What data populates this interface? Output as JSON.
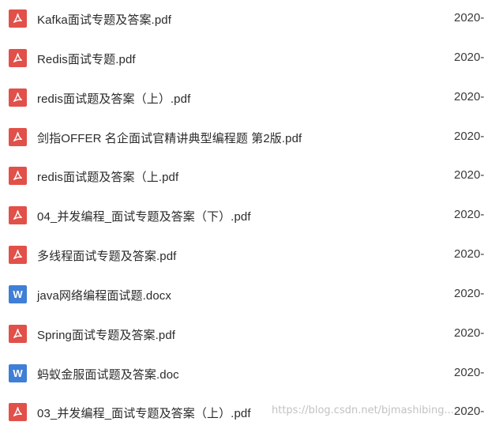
{
  "files": [
    {
      "name": "Kafka面试专题及答案.pdf",
      "date": "2020-",
      "icon": "pdf-icon",
      "icon_color": "#e2504a"
    },
    {
      "name": "Redis面试专题.pdf",
      "date": "2020-",
      "icon": "pdf-icon",
      "icon_color": "#e2504a"
    },
    {
      "name": "redis面试题及答案（上）.pdf",
      "date": "2020-",
      "icon": "pdf-icon",
      "icon_color": "#e2504a"
    },
    {
      "name": "剑指OFFER  名企面试官精讲典型编程题  第2版.pdf",
      "date": "2020-",
      "icon": "pdf-icon",
      "icon_color": "#e2504a"
    },
    {
      "name": "redis面试题及答案（上.pdf",
      "date": "2020-",
      "icon": "pdf-icon",
      "icon_color": "#e2504a"
    },
    {
      "name": "04_并发编程_面试专题及答案（下）.pdf",
      "date": "2020-",
      "icon": "pdf-icon",
      "icon_color": "#e2504a"
    },
    {
      "name": "多线程面试专题及答案.pdf",
      "date": "2020-",
      "icon": "pdf-icon",
      "icon_color": "#e2504a"
    },
    {
      "name": "java网络编程面试题.docx",
      "date": "2020-",
      "icon": "word-icon",
      "icon_color": "#3f7fd6"
    },
    {
      "name": "Spring面试专题及答案.pdf",
      "date": "2020-",
      "icon": "pdf-icon",
      "icon_color": "#e2504a"
    },
    {
      "name": "蚂蚁金服面试题及答案.doc",
      "date": "2020-",
      "icon": "word-icon",
      "icon_color": "#3f7fd6"
    },
    {
      "name": "03_并发编程_面试专题及答案（上）.pdf",
      "date": "2020-",
      "icon": "pdf-icon",
      "icon_color": "#e2504a"
    }
  ],
  "watermark": "https://blog.csdn.net/bjmashibing..."
}
